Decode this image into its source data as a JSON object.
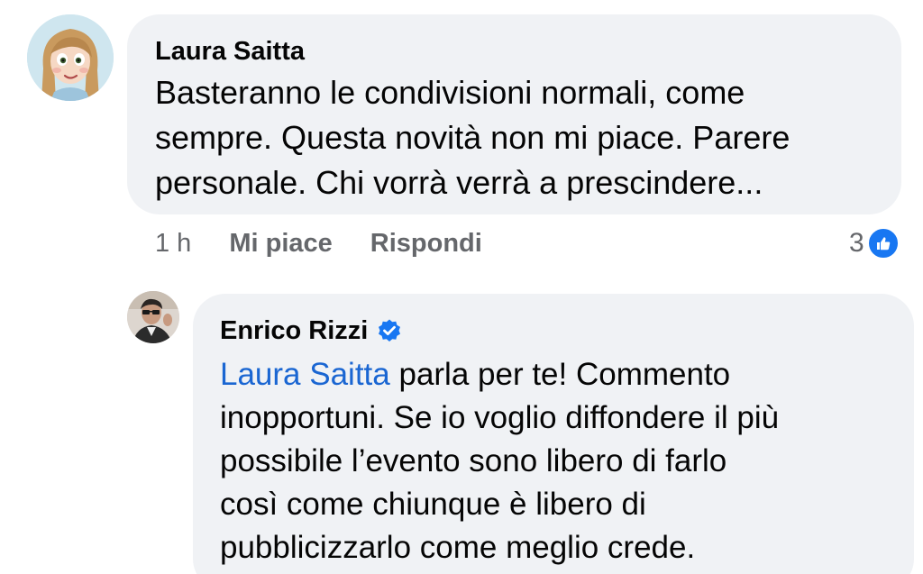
{
  "comment": {
    "author": "Laura Saitta",
    "text_lines": [
      "Basteranno le condivisioni normali, come",
      "sempre. Questa novità non mi piace. Parere",
      "personale. Chi vorrà verrà a prescindere..."
    ],
    "timestamp": "1 h",
    "like_label": "Mi piace",
    "reply_label": "Rispondi",
    "reaction_count": "3",
    "reaction_icon": "thumbs-up-icon",
    "avatar_icon": "cartoon-avatar-icon"
  },
  "reply": {
    "author": "Enrico Rizzi",
    "verified_icon": "verified-badge-icon",
    "avatar_icon": "user-photo-avatar",
    "mention": "Laura Saitta",
    "text_first": " parla per te! Commento",
    "text_lines": [
      "inopportuni. Se io voglio diffondere il più",
      "possibile l’evento sono libero di farlo",
      "così come chiunque è libero di",
      "pubblicizzarlo come meglio crede."
    ]
  },
  "colors": {
    "bubble_bg": "#f0f2f5",
    "meta_text": "#65676b",
    "link_blue": "#1a66d2",
    "facebook_blue": "#1877f2"
  }
}
